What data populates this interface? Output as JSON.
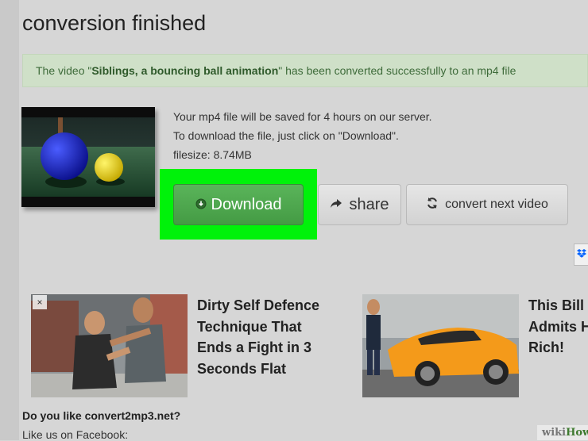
{
  "page": {
    "title": "conversion finished"
  },
  "notice": {
    "prefix": "The video \"",
    "video_title": "Siblings, a bouncing ball animation",
    "suffix": "\" has been converted successfully to an mp4 file"
  },
  "info": {
    "line1": "Your mp4 file will be saved for 4 hours on our server.",
    "line2": "To download the file, just click on \"Download\".",
    "filesize": "filesize: 8.74MB"
  },
  "buttons": {
    "download": "Download",
    "share": "share",
    "convert_next": "convert next video"
  },
  "ads": [
    {
      "title_lines": [
        "Dirty Self Defence",
        "Technique That",
        "Ends a Fight in 3",
        "Seconds Flat"
      ],
      "close": "×"
    },
    {
      "title_lines": [
        "This Bill",
        "Admits H",
        "Rich!"
      ]
    }
  ],
  "footer": {
    "question": "Do you like convert2mp3.net?",
    "like": "Like us on Facebook:"
  },
  "watermark": {
    "part1": "wiki",
    "part2": "How"
  },
  "colors": {
    "highlight": "#00f20a",
    "download_button": "#4caf50",
    "notice_bg": "#cfe0c8",
    "notice_text": "#3e6b3a"
  }
}
